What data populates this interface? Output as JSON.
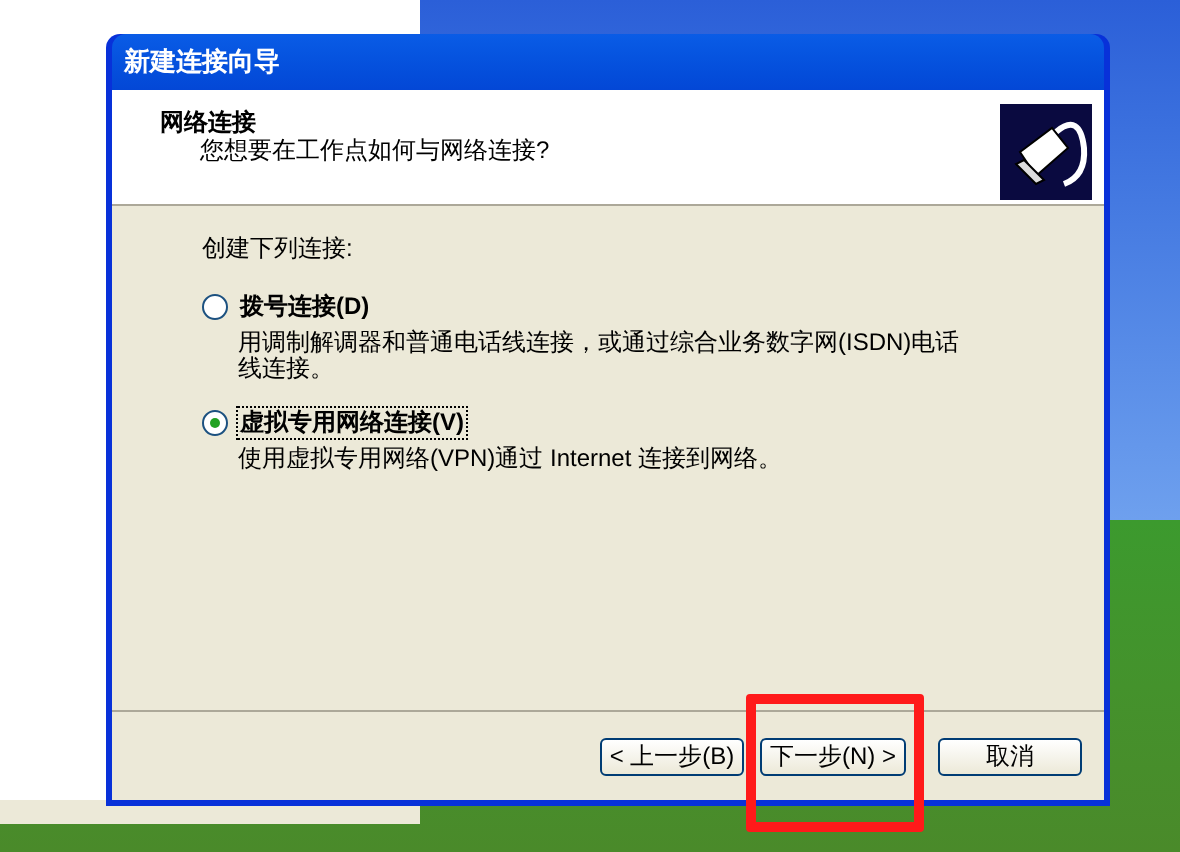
{
  "window": {
    "title": "新建连接向导"
  },
  "header": {
    "title": "网络连接",
    "subtitle": "您想要在工作点如何与网络连接?"
  },
  "prompt": "创建下列连接:",
  "options": [
    {
      "label": "拨号连接(D)",
      "description": "用调制解调器和普通电话线连接，或通过综合业务数字网(ISDN)电话线连接。",
      "selected": false
    },
    {
      "label": "虚拟专用网络连接(V)",
      "description": "使用虚拟专用网络(VPN)通过 Internet 连接到网络。",
      "selected": true
    }
  ],
  "buttons": [
    {
      "label": "< 上一步(B)",
      "kind": "back"
    },
    {
      "label": "下一步(N) >",
      "kind": "next"
    },
    {
      "label": "取消",
      "kind": "cancel"
    }
  ]
}
